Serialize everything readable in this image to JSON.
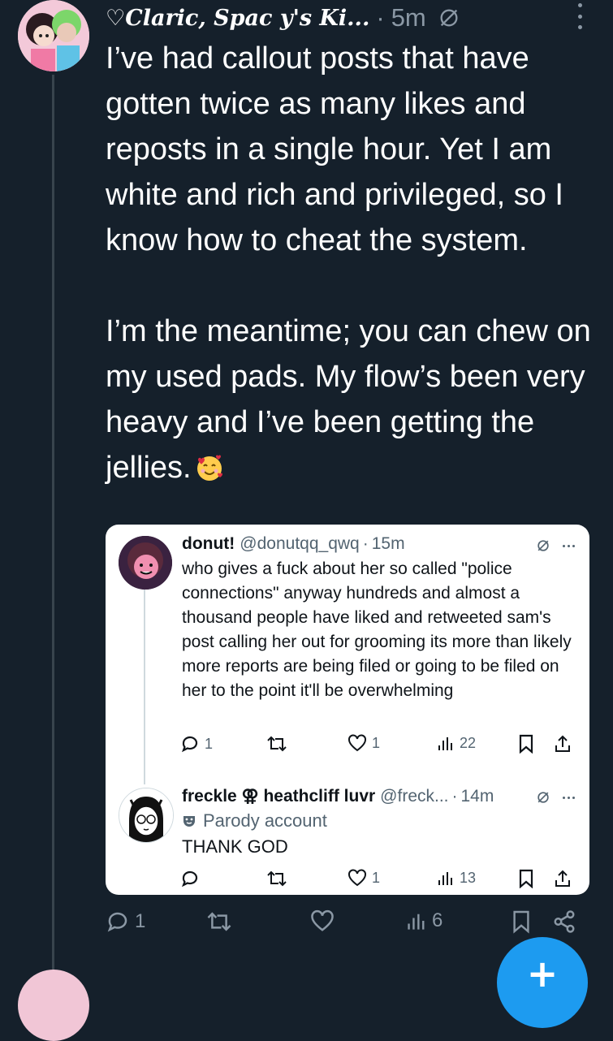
{
  "post": {
    "author_name": "♡Claric, Spac y's Ki...",
    "separator": "·",
    "time": "5m",
    "paragraphs": [
      "I’ve had callout posts that have gotten twice as many likes and reposts in a single hour.  Yet I am white and rich and privileged, so I know how to cheat the system.",
      "I’m the meantime; you can chew on my used pads.  My flow’s been very heavy and I’ve been getting the jellies."
    ],
    "emoji_name": "smiling-face-with-hearts",
    "actions": {
      "replies": "1",
      "reposts": "",
      "likes": "",
      "views": "6"
    }
  },
  "quote": {
    "first": {
      "name": "donut!",
      "handle": "@donutqq_qwq",
      "separator": "·",
      "time": "15m",
      "text": "who gives a fuck about her so called \"police connections\" anyway hundreds and almost a thousand people have liked and retweeted sam's post calling her out for grooming its more than likely more reports are being filed or going to be filed on her to the point it'll be overwhelming",
      "replies": "1",
      "likes": "1",
      "views": "22"
    },
    "second": {
      "name": "freckle ⚢ heathcliff luvr",
      "handle": "@freck...",
      "separator": "·",
      "time": "14m",
      "parody_label": "Parody account",
      "text": "THANK GOD",
      "replies": "",
      "likes": "1",
      "views": "13"
    }
  },
  "colors": {
    "background": "#15202b",
    "text": "#ffffff",
    "muted": "#8b98a5",
    "accent": "#1d9bf0",
    "card_background": "#ffffff"
  },
  "icons": [
    "grok-icon",
    "more-icon",
    "reply-icon",
    "repost-icon",
    "like-icon",
    "views-icon",
    "bookmark-icon",
    "share-icon",
    "compose-icon",
    "parody-icon"
  ]
}
